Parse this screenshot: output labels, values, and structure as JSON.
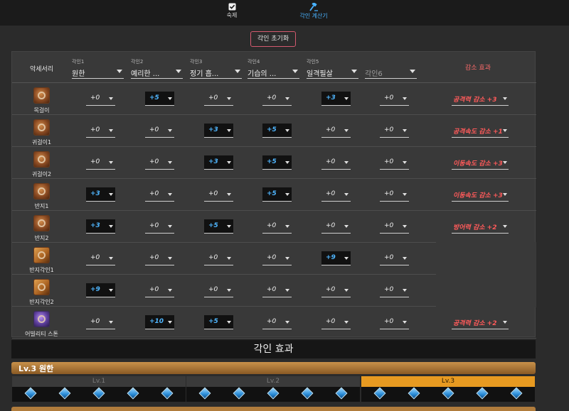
{
  "nav": {
    "homework_label": "숙제",
    "calculator_label": "각인 계산기"
  },
  "reset_label": "각인 초기화",
  "header": {
    "accessory_label": "악세서리",
    "effect_label": "감소 효과",
    "engravings": [
      {
        "label": "각인1",
        "value": "원한"
      },
      {
        "label": "각인2",
        "value": "예리한 ..."
      },
      {
        "label": "각인3",
        "value": "정기 흡..."
      },
      {
        "label": "각인4",
        "value": "기습의 ..."
      },
      {
        "label": "각인5",
        "value": "일격필살"
      },
      {
        "label": "",
        "value": "각인6"
      }
    ]
  },
  "rows": [
    {
      "name": "목걸이",
      "icon": "necklace-icon",
      "values": [
        "+0",
        "+5",
        "+0",
        "+0",
        "+3",
        "+0"
      ],
      "effect": "공격력 감소 +3"
    },
    {
      "name": "귀걸이1",
      "icon": "earring-icon",
      "values": [
        "+0",
        "+0",
        "+3",
        "+5",
        "+0",
        "+0"
      ],
      "effect": "공격속도 감소 +1"
    },
    {
      "name": "귀걸이2",
      "icon": "earring-icon",
      "values": [
        "+0",
        "+0",
        "+3",
        "+5",
        "+0",
        "+0"
      ],
      "effect": "이동속도 감소 +3"
    },
    {
      "name": "반지1",
      "icon": "ring-icon",
      "values": [
        "+3",
        "+0",
        "+0",
        "+5",
        "+0",
        "+0"
      ],
      "effect": "이동속도 감소 +3"
    },
    {
      "name": "반지2",
      "icon": "ring-icon",
      "values": [
        "+3",
        "+0",
        "+5",
        "+0",
        "+0",
        "+0"
      ],
      "effect": "방어력 감소 +2"
    },
    {
      "name": "반지각인1",
      "icon": "engraving-book-icon",
      "values": [
        "+0",
        "+0",
        "+0",
        "+0",
        "+9",
        "+0"
      ],
      "effect": ""
    },
    {
      "name": "반지각인2",
      "icon": "engraving-book-icon",
      "values": [
        "+9",
        "+0",
        "+0",
        "+0",
        "+0",
        "+0"
      ],
      "effect": ""
    },
    {
      "name": "어빌리티 스톤",
      "icon": "ability-stone-icon",
      "values": [
        "+0",
        "+10",
        "+5",
        "+0",
        "+0",
        "+0"
      ],
      "effect": "공격력 감소 +2"
    }
  ],
  "section_title": "각인 효과",
  "level_head": "Lv.3 원한",
  "levels": [
    "Lv.1",
    "Lv.2",
    "Lv.3"
  ],
  "active_level_index": 2,
  "colors": {
    "highlight_value": "#4fb6ff",
    "effect_text": "#ff5a5a",
    "accent_gold": "#e79a21"
  }
}
